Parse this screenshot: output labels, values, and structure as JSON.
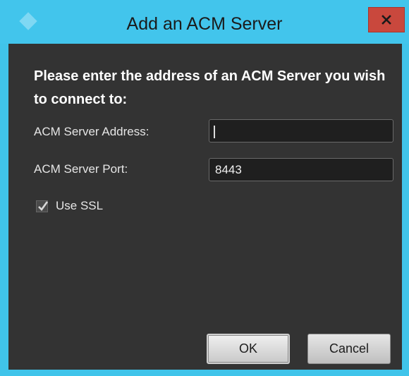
{
  "window": {
    "title": "Add an ACM Server",
    "close_glyph": "x"
  },
  "dialog": {
    "heading": "Please enter the address of an ACM Server you wish to connect to:",
    "address": {
      "label": "ACM Server Address:",
      "value": ""
    },
    "port": {
      "label": "ACM Server Port:",
      "value": "8443"
    },
    "ssl": {
      "label": "Use SSL",
      "checked": true
    }
  },
  "buttons": {
    "ok_label": "OK",
    "cancel_label": "Cancel"
  },
  "colors": {
    "title_bar": "#42c5ec",
    "client_bg": "#333333",
    "close_button": "#c9483d"
  },
  "icons": {
    "app": "diamond-app-icon",
    "close": "close-icon",
    "check": "checkmark-icon"
  }
}
